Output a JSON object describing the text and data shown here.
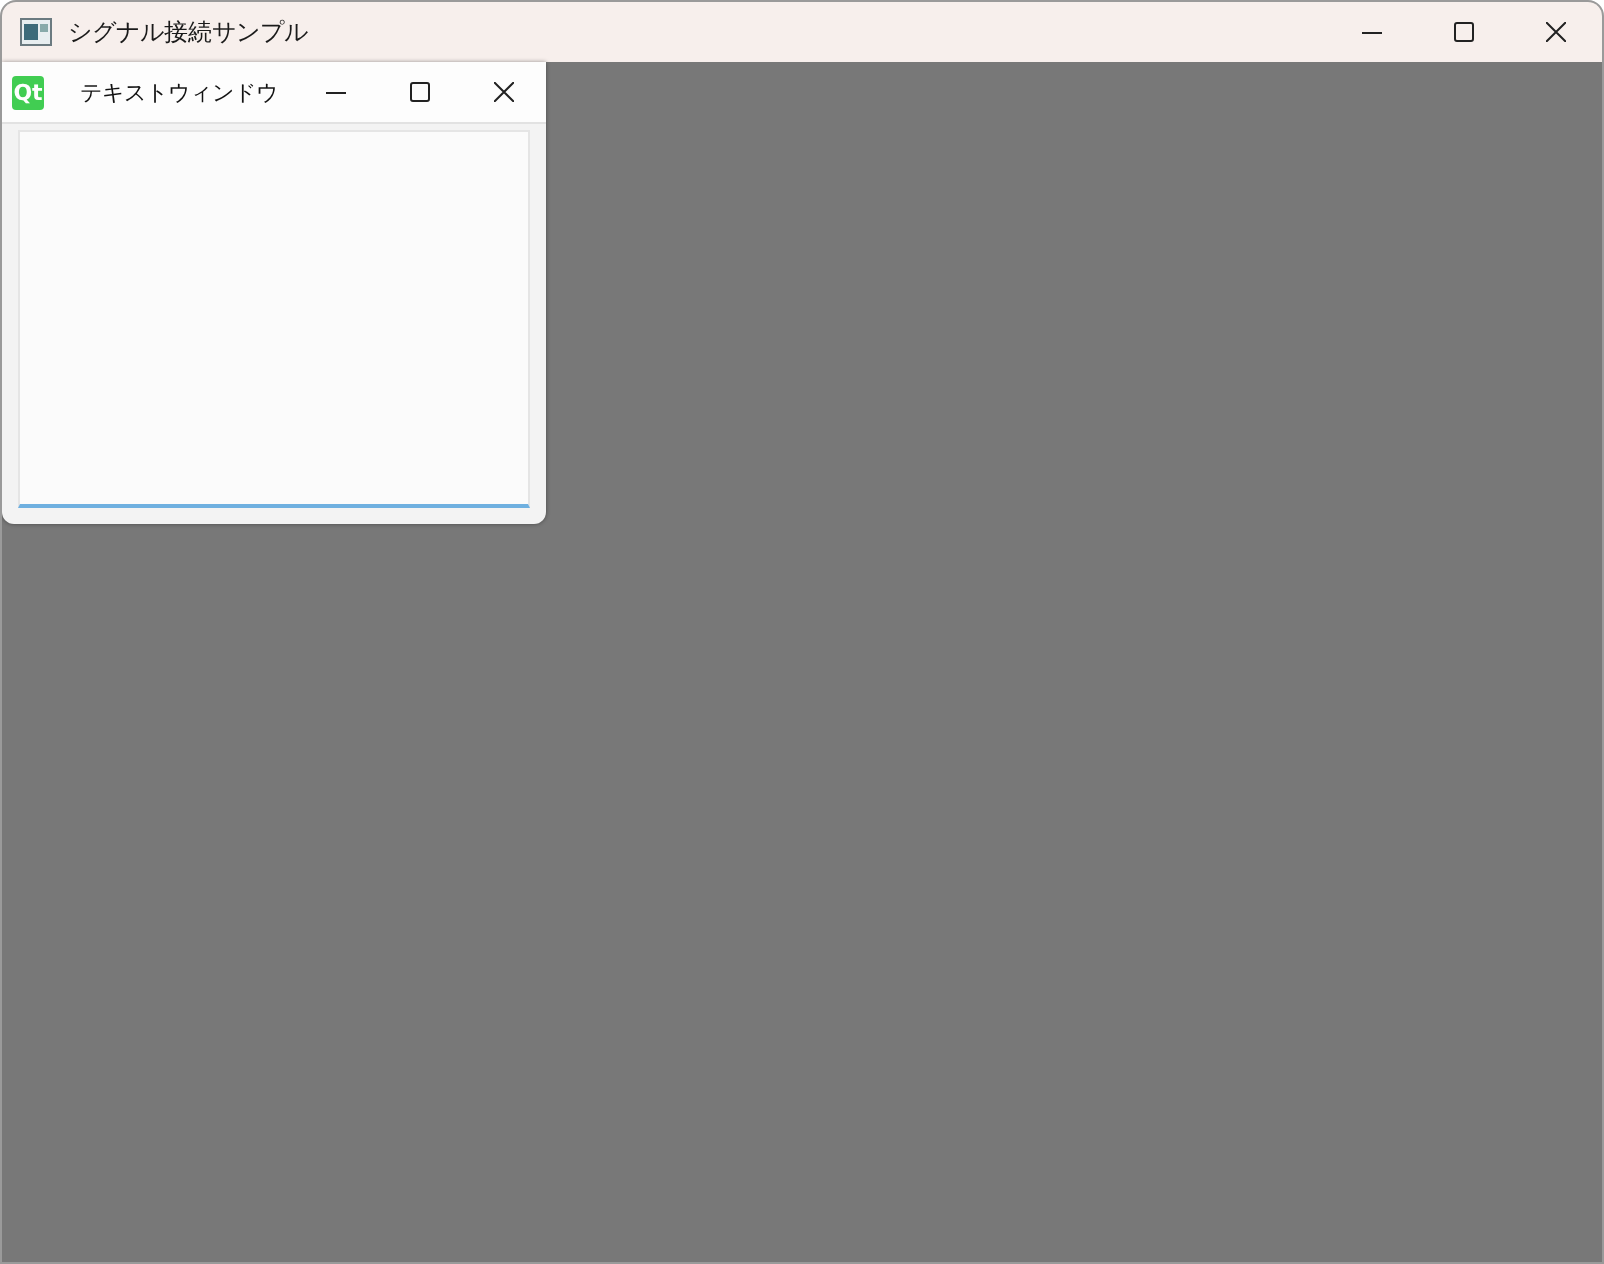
{
  "window": {
    "title": "シグナル接続サンプル"
  },
  "subwindow": {
    "logo": "Qt",
    "title": "テキストウィンドウ",
    "text_edit": {
      "focused": true
    }
  }
}
